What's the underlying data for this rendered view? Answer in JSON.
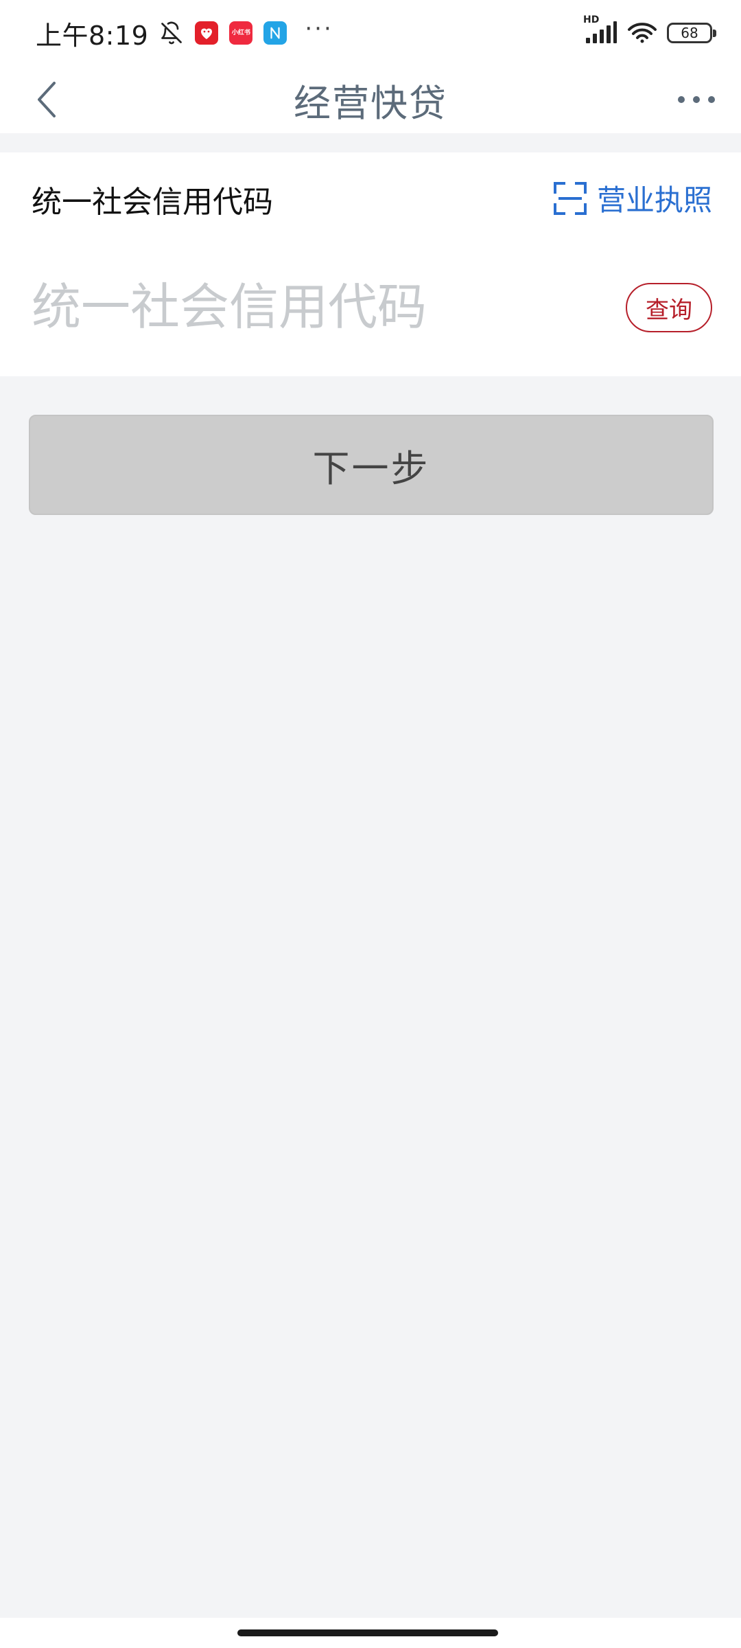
{
  "status_bar": {
    "time": "上午8:19",
    "notification_icons": [
      "bell-muted-icon",
      "pinduoduo-icon",
      "xiaohongshu-icon",
      "nfc-icon"
    ],
    "xiaohongshu_label": "小红书",
    "overflow": "···",
    "network_label": "HD",
    "battery": "68"
  },
  "nav": {
    "title": "经营快贷",
    "back_icon": "chevron-left-icon",
    "more_icon": "more-horizontal-icon"
  },
  "form": {
    "label": "统一社会信用代码",
    "scan_link_label": "营业执照",
    "scan_icon": "scan-icon",
    "input_placeholder": "统一社会信用代码",
    "input_value": "",
    "query_label": "查询"
  },
  "actions": {
    "next_label": "下一步"
  },
  "colors": {
    "link_blue": "#2a6fd1",
    "query_red": "#b61f2a",
    "title_gray": "#5c6b7a",
    "disabled_button": "#cccccc",
    "background": "#f3f4f6"
  }
}
